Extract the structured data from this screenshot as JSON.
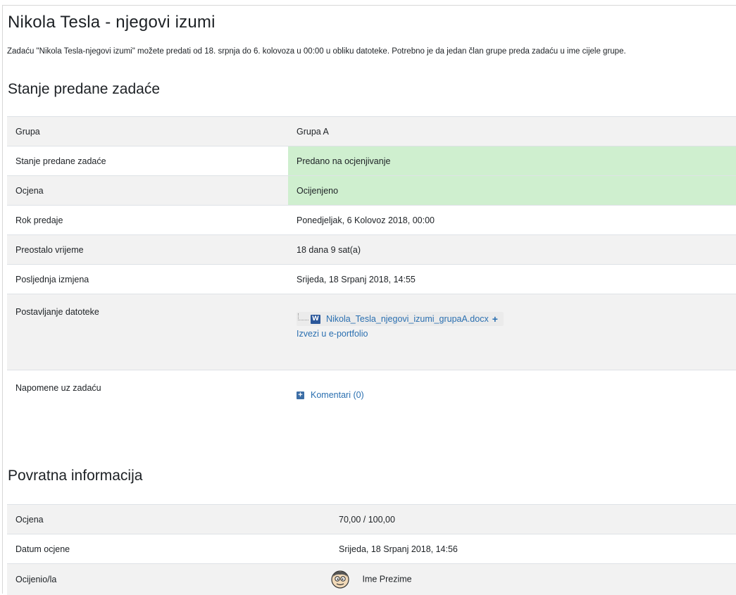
{
  "page": {
    "title": "Nikola Tesla - njegovi izumi",
    "intro": "Zadaću \"Nikola Tesla-njegovi izumi\" možete predati od 18. srpnja do  6. kolovoza u 00:00 u obliku datoteke. Potrebno je da jedan član grupe preda zadaću u ime cijele grupe."
  },
  "submission": {
    "heading": "Stanje predane zadaće",
    "rows": [
      {
        "label": "Grupa",
        "value": "Grupa A"
      },
      {
        "label": "Stanje predane zadaće",
        "value": "Predano na ocjenjivanje"
      },
      {
        "label": "Ocjena",
        "value": "Ocijenjeno"
      },
      {
        "label": "Rok predaje",
        "value": "Ponedjeljak, 6 Kolovoz 2018, 00:00"
      },
      {
        "label": "Preostalo vrijeme",
        "value": "18 dana 9 sat(a)"
      },
      {
        "label": "Posljednja izmjena",
        "value": "Srijeda, 18 Srpanj 2018, 14:55"
      },
      {
        "label": "Postavljanje datoteke"
      },
      {
        "label": "Napomene uz zadaću"
      }
    ],
    "file_name": "Nikola_Tesla_njegovi_izumi_grupaA.docx",
    "file_icon": "word-doc-icon",
    "file_icon_glyph": "W",
    "file_plus": "+",
    "export_link": "Izvezi u e-portfolio",
    "comments_link": "Komentari (0)",
    "comments_icon": "plus-square-icon",
    "comments_icon_glyph": "+"
  },
  "feedback": {
    "heading": "Povratna informacija",
    "rows": [
      {
        "label": "Ocjena",
        "value": "70,00 / 100,00"
      },
      {
        "label": "Datum ocjene",
        "value": "Srijeda, 18 Srpanj 2018, 14:56"
      },
      {
        "label": "Ocijenio/la",
        "value": "Ime Prezime"
      }
    ]
  },
  "colors": {
    "success_bg": "#cfefcf",
    "row_alt_bg": "#f2f2f2",
    "link": "#2a6fb0"
  }
}
